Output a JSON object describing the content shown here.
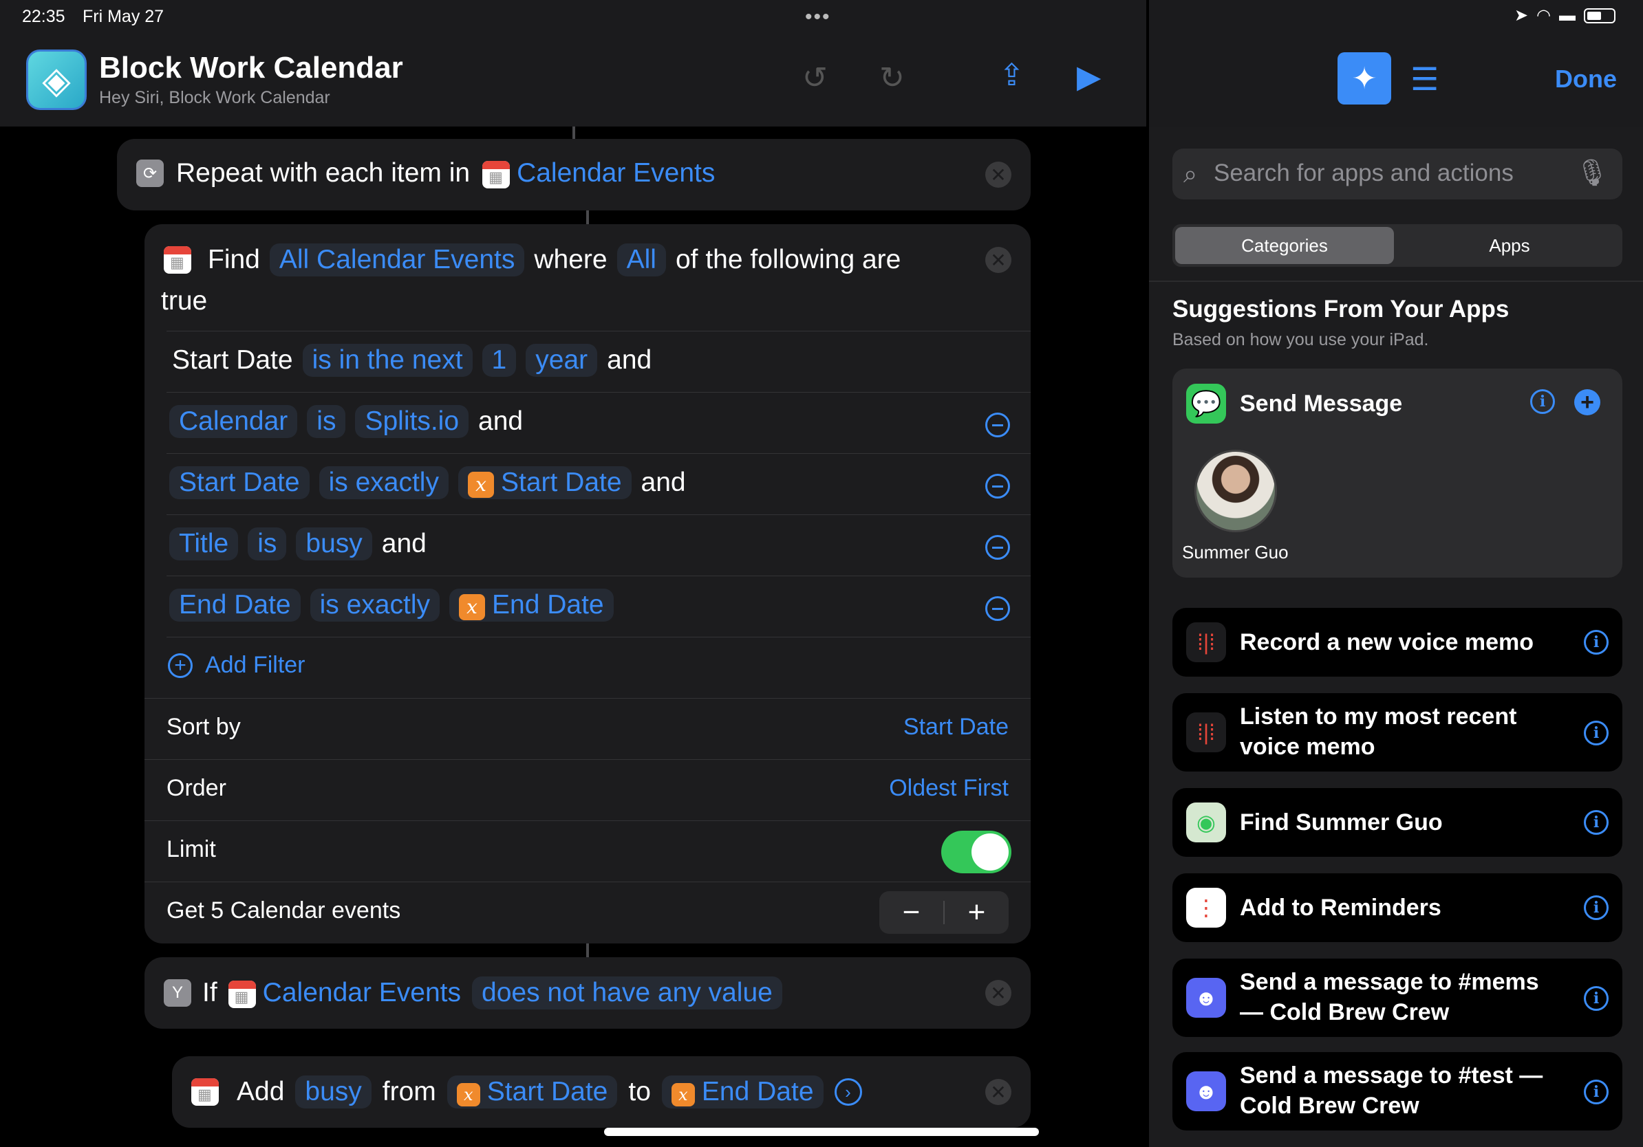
{
  "status_bar": {
    "time": "22:35",
    "date": "Fri May 27",
    "dots": "•••"
  },
  "header": {
    "title": "Block Work Calendar",
    "subtitle": "Hey Siri, Block Work Calendar"
  },
  "repeat": {
    "label": "Repeat with each item in",
    "variable": "Calendar Events"
  },
  "find": {
    "find_label": "Find",
    "source": "All Calendar Events",
    "where_label": "where",
    "quantifier": "All",
    "suffix": "of the following are",
    "suffix2": "true",
    "filters": [
      {
        "field": "Start Date",
        "op": "is in the next",
        "value": "1",
        "unit": "year",
        "join": "and"
      },
      {
        "field": "Calendar",
        "op": "is",
        "value": "Splits.io",
        "join": "and"
      },
      {
        "field": "Start Date",
        "op": "is exactly",
        "value": "Start Date",
        "join": "and"
      },
      {
        "field": "Title",
        "op": "is",
        "value": "busy",
        "join": "and"
      },
      {
        "field": "End Date",
        "op": "is exactly",
        "value": "End Date"
      }
    ],
    "add_filter": "Add Filter",
    "sort_by_label": "Sort by",
    "sort_by_value": "Start Date",
    "order_label": "Order",
    "order_value": "Oldest First",
    "limit_label": "Limit",
    "limit_on": true,
    "get_label": "Get 5 Calendar events",
    "stepper_minus": "−",
    "stepper_plus": "+"
  },
  "if_block": {
    "label": "If",
    "variable": "Calendar Events",
    "condition": "does not have any value"
  },
  "add_block": {
    "label": "Add",
    "title": "busy",
    "from": "from",
    "start": "Start Date",
    "to": "to",
    "end": "End Date"
  },
  "sidebar": {
    "done": "Done",
    "search_placeholder": "Search for apps and actions",
    "tabs": [
      "Categories",
      "Apps"
    ],
    "suggestions_title": "Suggestions From Your Apps",
    "suggestions_subtitle": "Based on how you use your iPad.",
    "send_message": "Send Message",
    "contact_name": "Summer Guo",
    "actions": [
      "Record a new voice memo",
      "Listen to my most recent voice memo",
      "Find Summer Guo",
      "Add to Reminders",
      "Send a message to #mems — Cold Brew Crew",
      "Send a message to #test — Cold Brew Crew"
    ]
  },
  "colors": {
    "accent": "#3b8cf7",
    "toggle_on": "#34c759",
    "variable": "#f08a2c"
  }
}
